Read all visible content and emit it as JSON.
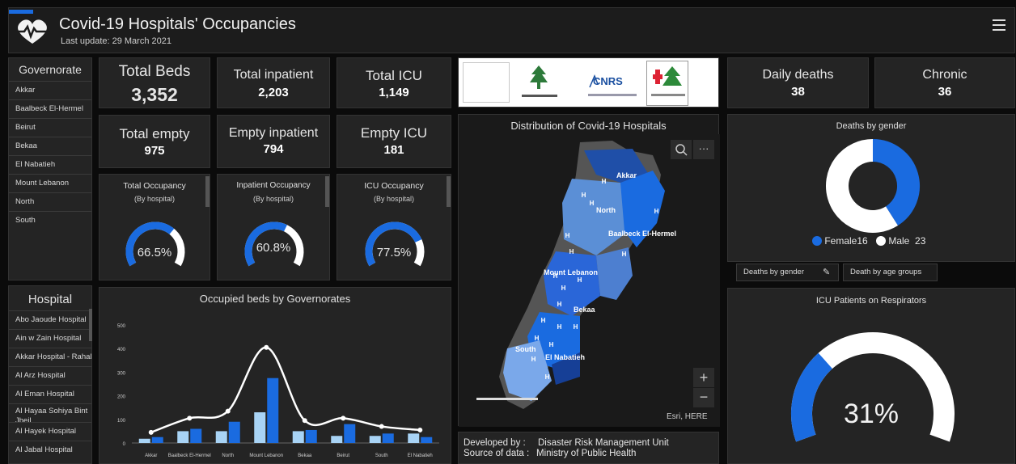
{
  "header": {
    "title": "Covid-19 Hospitals' Occupancies",
    "subtitle": "Last update: 29 March 2021"
  },
  "governorates": {
    "title": "Governorate",
    "items": [
      "Akkar",
      "Baalbeck El-Hermel",
      "Beirut",
      "Bekaa",
      "El Nabatieh",
      "Mount Lebanon",
      "North",
      "South"
    ]
  },
  "hospitals": {
    "title": "Hospital",
    "items": [
      "Abo Jaoude Hospital",
      "Ain w Zain Hospital",
      "Akkar Hospital - Rahal",
      "Al Arz Hospital",
      "Al Eman Hospital",
      "Al Hayaa Sohiya Bint Jbeil",
      "Al Hayek Hospital",
      "Al Jabal Hospital"
    ]
  },
  "stats": {
    "total_beds": {
      "label": "Total Beds",
      "value": "3,352"
    },
    "total_inpatient": {
      "label": "Total inpatient",
      "value": "2,203"
    },
    "total_icu": {
      "label": "Total ICU",
      "value": "1,149"
    },
    "total_empty": {
      "label": "Total empty",
      "value": "975"
    },
    "empty_inpatient": {
      "label": "Empty inpatient",
      "value": "794"
    },
    "empty_icu": {
      "label": "Empty ICU",
      "value": "181"
    },
    "daily_deaths": {
      "label": "Daily deaths",
      "value": "38"
    },
    "chronic": {
      "label": "Chronic",
      "value": "36"
    }
  },
  "gauges": [
    {
      "title": "Total Occupancy",
      "sub": "(By hospital)",
      "value_text": "66.5%",
      "fraction": 0.665
    },
    {
      "title": "Inpatient Occupancy",
      "sub": "(By hospital)",
      "value_text": "60.8%",
      "fraction": 0.608
    },
    {
      "title": "ICU Occupancy",
      "sub": "(By hospital)",
      "value_text": "77.5%",
      "fraction": 0.775
    }
  ],
  "map": {
    "title": "Distribution of Covid-19 Hospitals",
    "labels": [
      "Akkar",
      "North",
      "Baalbeck El-Hermel",
      "Mount Lebanon",
      "Bekaa",
      "South",
      "El Nabatieh"
    ],
    "attribution": "Esri, HERE",
    "zoom_in": "+",
    "zoom_out": "−",
    "search_icon": "search-icon",
    "more_icon": "more-icon"
  },
  "footer": {
    "developed_label": "Developed by :",
    "developed_value": "Disaster Risk Management Unit",
    "source_label": "Source of data :",
    "source_value": "Ministry of Public Health"
  },
  "deaths_by_gender": {
    "title": "Deaths by gender",
    "legend": [
      {
        "label": "Female",
        "value": "16",
        "color": "#1a6be0"
      },
      {
        "label": "Male",
        "value": "23",
        "color": "#ffffff"
      }
    ],
    "tabs": [
      "Deaths by gender",
      "Death by age groups"
    ]
  },
  "icu_respirators": {
    "title": "ICU Patients on Respirators",
    "value_text": "31%",
    "fraction": 0.31
  },
  "chart_data": {
    "type": "bar",
    "title": "Occupied beds by Governorates",
    "categories": [
      "Akkar",
      "Baalbeck El-Hermel",
      "North",
      "Mount Lebanon",
      "Bekaa",
      "Beirut",
      "South",
      "El Nabatieh"
    ],
    "series": [
      {
        "values": [
          18,
          50,
          50,
          130,
          50,
          30,
          30,
          40
        ],
        "color": "#a8d3f5"
      },
      {
        "values": [
          25,
          60,
          90,
          275,
          55,
          80,
          40,
          25
        ],
        "color": "#1a6be0"
      }
    ],
    "line": {
      "values": [
        45,
        105,
        135,
        405,
        95,
        105,
        70,
        55
      ],
      "color": "#ffffff"
    },
    "ylim": [
      0,
      500
    ],
    "yticks": [
      "0",
      "100",
      "200",
      "300",
      "400",
      "500"
    ]
  },
  "colors": {
    "accent": "#1a6be0",
    "light": "#a8d3f5",
    "panel": "#242424"
  }
}
